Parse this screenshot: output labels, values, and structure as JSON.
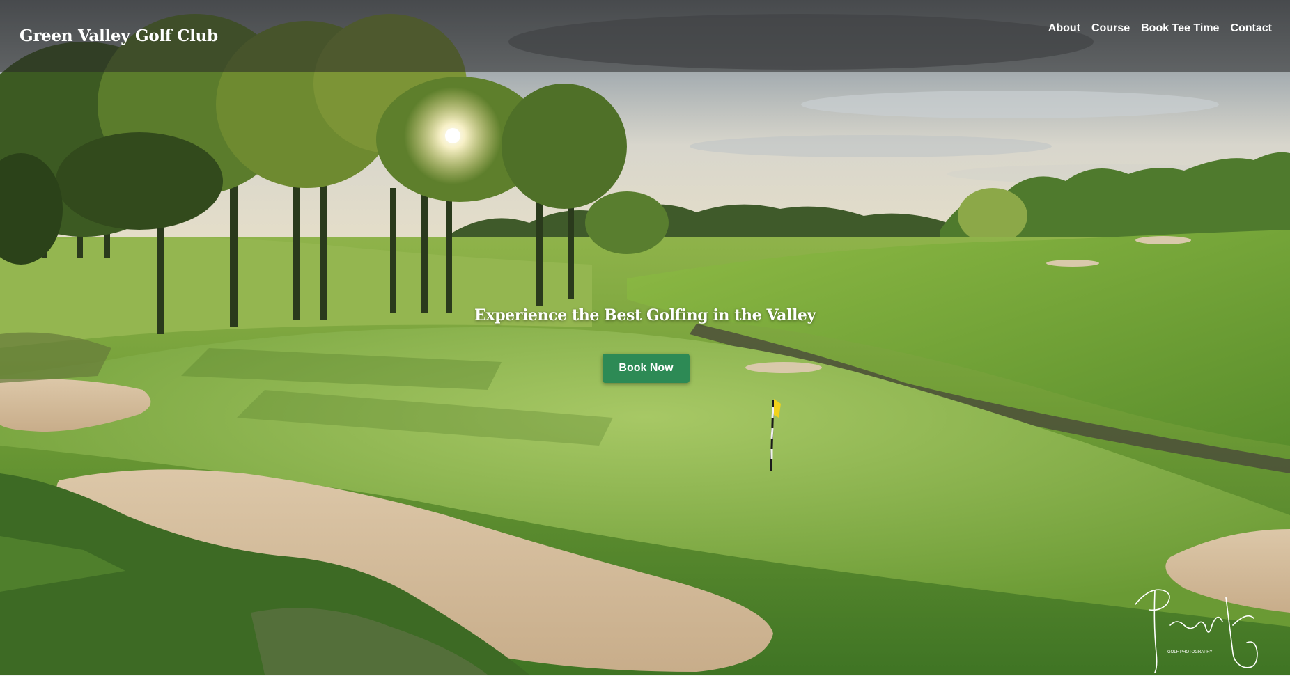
{
  "header": {
    "brand": "Green Valley Golf Club",
    "nav": [
      {
        "label": "About"
      },
      {
        "label": "Course"
      },
      {
        "label": "Book Tee Time"
      },
      {
        "label": "Contact"
      }
    ]
  },
  "hero": {
    "tagline": "Experience the Best Golfing in the Valley",
    "cta_label": "Book Now",
    "image_subject": "golf course green at sunrise with trees, bunkers, creek and flagstick",
    "watermark_text": "GOLF PHOTOGRAPHY"
  },
  "colors": {
    "header_overlay": "rgba(40,40,40,0.55)",
    "cta_background": "#2d8a55",
    "text": "#ffffff"
  }
}
